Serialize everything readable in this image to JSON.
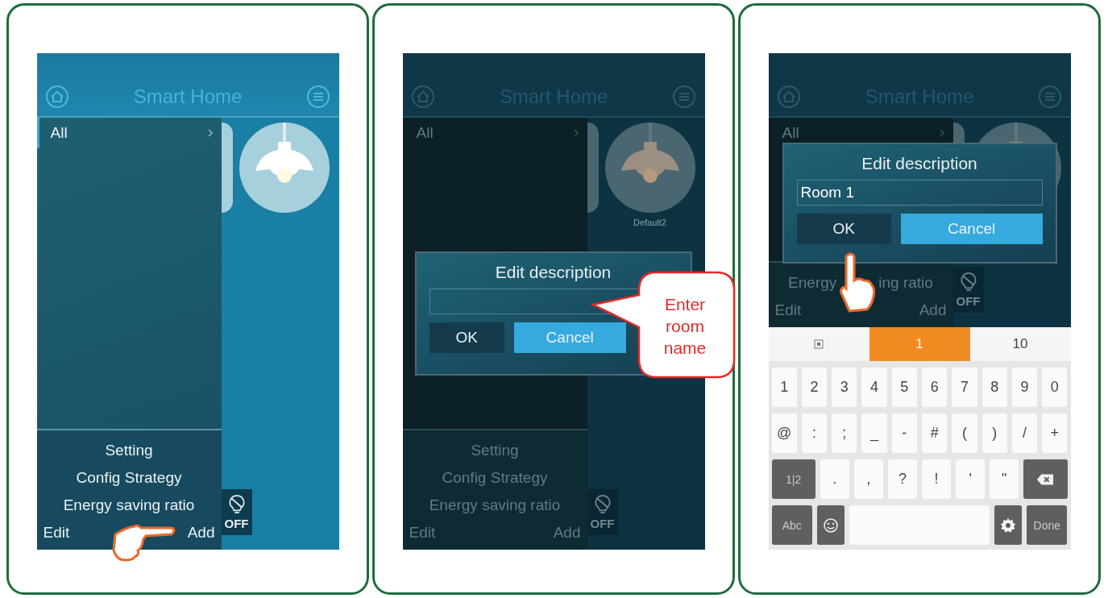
{
  "panels": [
    {
      "dimmed": false,
      "title": "Smart Home",
      "drawer_items": [
        {
          "label": "All",
          "selected": true
        }
      ],
      "menu": [
        [
          "Setting"
        ],
        [
          "Config Strategy"
        ],
        [
          "Energy saving ratio"
        ]
      ],
      "edit": "Edit",
      "add": "Add",
      "off_label": "OFF",
      "hand": {
        "kind": "point-right"
      }
    },
    {
      "dimmed": true,
      "title": "Smart Home",
      "drawer_items": [
        {
          "label": "All",
          "selected": false
        }
      ],
      "menu": [
        [
          "Setting"
        ],
        [
          "Config Strategy"
        ],
        [
          "Energy saving ratio"
        ]
      ],
      "edit": "Edit",
      "add": "Add",
      "device_label": "Default2",
      "off_label": "OFF",
      "dialog": {
        "title": "Edit description",
        "ok": "OK",
        "cancel": "Cancel"
      },
      "callout": {
        "text": "Enter room name"
      }
    },
    {
      "dimmed": true,
      "title": "Smart Home",
      "drawer_items": [
        {
          "label": "All",
          "selected": false
        }
      ],
      "menu": [
        [
          "Energy",
          "ing ratio"
        ]
      ],
      "edit": "Edit",
      "add": "Add",
      "off_label": "OFF",
      "dialog": {
        "title": "Edit description",
        "value": "Room 1",
        "ok": "OK",
        "cancel": "Cancel"
      },
      "hand": {
        "kind": "point-up"
      },
      "keyboard": {
        "candidates": [
          {
            "kind": "icon",
            "selected": false
          },
          {
            "kind": "text",
            "label": "1",
            "selected": true
          },
          {
            "kind": "text",
            "label": "10",
            "selected": false
          }
        ],
        "key_rows": [
          {
            "keys": [
              {
                "kind": "char",
                "label": "1"
              },
              {
                "kind": "char",
                "label": "2"
              },
              {
                "kind": "char",
                "label": "3"
              },
              {
                "kind": "char",
                "label": "4"
              },
              {
                "kind": "char",
                "label": "5"
              },
              {
                "kind": "char",
                "label": "6"
              },
              {
                "kind": "char",
                "label": "7"
              },
              {
                "kind": "char",
                "label": "8"
              },
              {
                "kind": "char",
                "label": "9"
              },
              {
                "kind": "char",
                "label": "0"
              }
            ]
          },
          {
            "keys": [
              {
                "kind": "char",
                "label": "@"
              },
              {
                "kind": "char",
                "label": ":"
              },
              {
                "kind": "char",
                "label": ";"
              },
              {
                "kind": "char",
                "label": "_"
              },
              {
                "kind": "char",
                "label": "-"
              },
              {
                "kind": "char",
                "label": "#"
              },
              {
                "kind": "char",
                "label": "("
              },
              {
                "kind": "char",
                "label": ")"
              },
              {
                "kind": "char",
                "label": "/"
              },
              {
                "kind": "char",
                "label": "+"
              }
            ]
          },
          {
            "keys": [
              {
                "kind": "dark",
                "label": "1|2"
              },
              {
                "kind": "char",
                "label": "."
              },
              {
                "kind": "char",
                "label": ","
              },
              {
                "kind": "char",
                "label": "?"
              },
              {
                "kind": "char",
                "label": "!"
              },
              {
                "kind": "char",
                "label": "'"
              },
              {
                "kind": "char",
                "label": "\""
              },
              {
                "kind": "backspace"
              }
            ]
          },
          {
            "keys": [
              {
                "kind": "dark",
                "label": "Abc"
              },
              {
                "kind": "emoji"
              },
              {
                "kind": "space"
              },
              {
                "kind": "settings"
              },
              {
                "kind": "dark",
                "label": "Done"
              }
            ]
          }
        ]
      }
    }
  ]
}
